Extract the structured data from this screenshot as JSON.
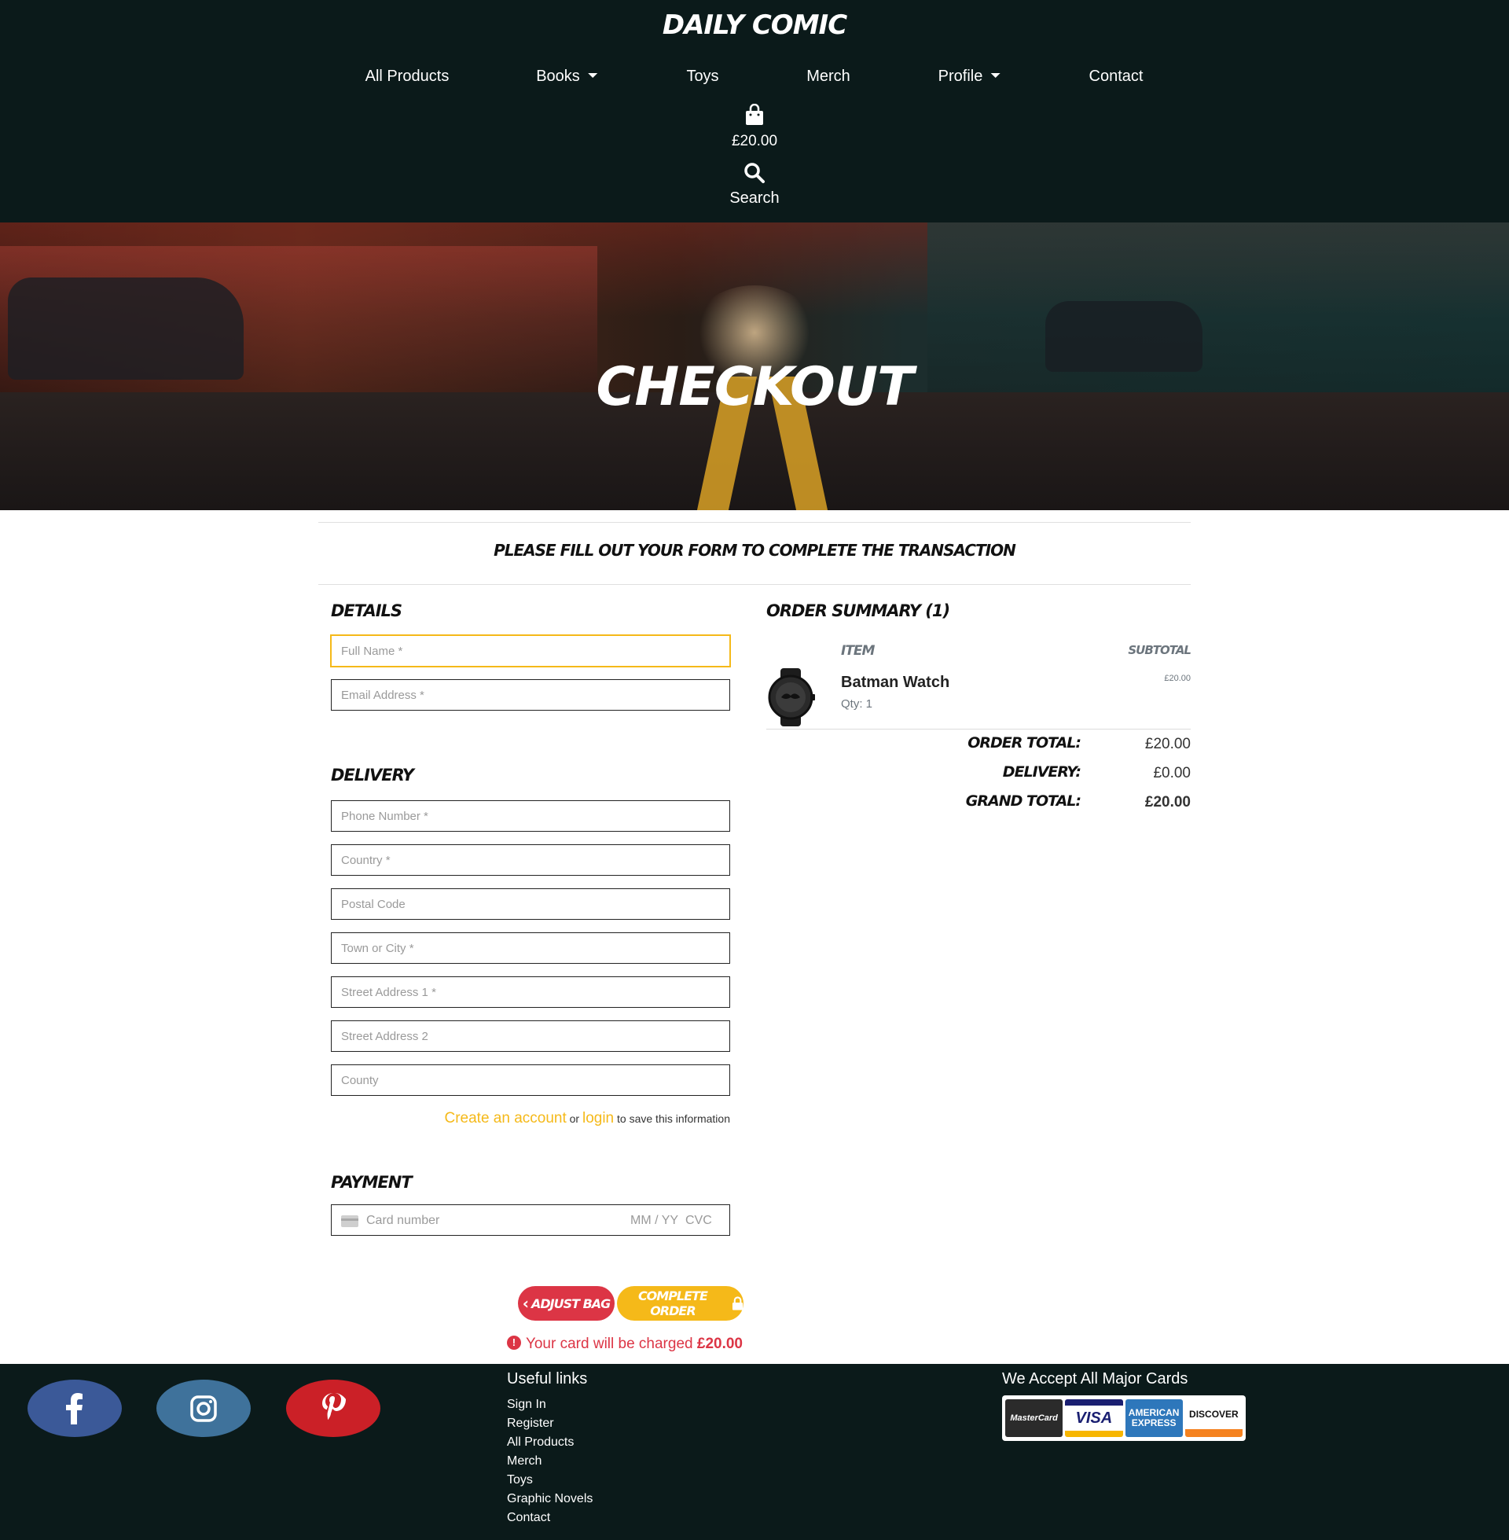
{
  "header": {
    "brand": "DAILY COMIC",
    "nav": [
      {
        "label": "All Products",
        "dropdown": false
      },
      {
        "label": "Books",
        "dropdown": true
      },
      {
        "label": "Toys",
        "dropdown": false
      },
      {
        "label": "Merch",
        "dropdown": false
      },
      {
        "label": "Profile",
        "dropdown": true
      },
      {
        "label": "Contact",
        "dropdown": false
      }
    ],
    "bag": {
      "icon": "shopping-bag-icon",
      "total": "£20.00"
    },
    "search": {
      "icon": "search-icon",
      "label": "Search"
    }
  },
  "hero": {
    "title": "CHECKOUT"
  },
  "intro": "PLEASE FILL OUT YOUR FORM TO COMPLETE THE TRANSACTION",
  "form": {
    "details_title": "DETAILS",
    "full_name_placeholder": "Full Name *",
    "email_placeholder": "Email Address *",
    "delivery_title": "DELIVERY",
    "phone_placeholder": "Phone Number *",
    "country_placeholder": "Country *",
    "postal_placeholder": "Postal Code",
    "town_placeholder": "Town or City *",
    "street1_placeholder": "Street Address 1 *",
    "street2_placeholder": "Street Address 2",
    "county_placeholder": "County",
    "save_info": {
      "create": "Create an account",
      "or": "or",
      "login": "login",
      "rest": "to save this information"
    },
    "payment_title": "PAYMENT",
    "card": {
      "number_placeholder": "Card number",
      "expiry_placeholder": "MM / YY",
      "cvc_placeholder": "CVC"
    }
  },
  "buttons": {
    "adjust": "ADJUST BAG",
    "complete": "COMPLETE ORDER"
  },
  "charge_note": {
    "text": "Your card will be charged",
    "amount": "£20.00"
  },
  "summary": {
    "title": "ORDER SUMMARY (1)",
    "col_item": "ITEM",
    "col_subtotal": "SUBTOTAL",
    "item": {
      "name": "Batman Watch",
      "qty": "Qty: 1",
      "price": "£20.00"
    },
    "order_total_label": "ORDER TOTAL:",
    "order_total": "£20.00",
    "delivery_label": "DELIVERY:",
    "delivery": "£0.00",
    "grand_total_label": "GRAND TOTAL:",
    "grand_total": "£20.00"
  },
  "footer": {
    "social": [
      "facebook-icon",
      "instagram-icon",
      "pinterest-icon"
    ],
    "links_title": "Useful links",
    "links": [
      "Sign In",
      "Register",
      "All Products",
      "Merch",
      "Toys",
      "Graphic Novels",
      "Contact"
    ],
    "cards_title": "We Accept All Major Cards",
    "cards": {
      "mastercard": "MasterCard",
      "visa": "VISA",
      "amex": "AMERICAN EXPRESS",
      "discover": "DISCOVER"
    }
  },
  "colors": {
    "header_bg": "#0b1a1a",
    "accent": "#f5b919",
    "danger": "#dc3545"
  }
}
